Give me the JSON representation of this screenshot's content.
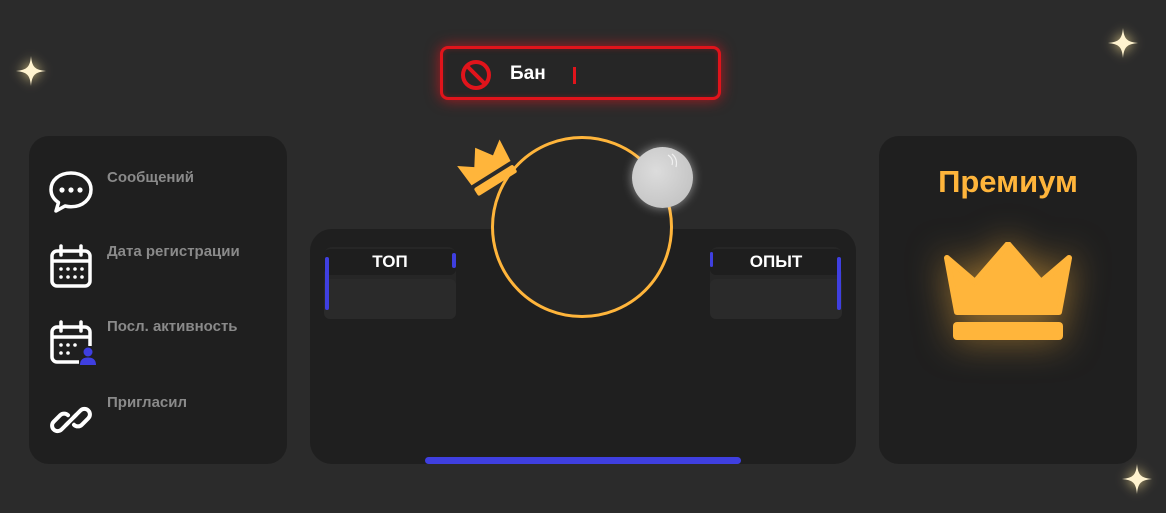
{
  "ban": {
    "label": "Бан",
    "icon": "ban-icon",
    "color": "#e0141b"
  },
  "info": {
    "items": [
      {
        "label": "Сообщений",
        "icon": "chat-bubble-icon"
      },
      {
        "label": "Дата регистрации",
        "icon": "calendar-icon"
      },
      {
        "label": "Посл. активность",
        "icon": "calendar-user-icon"
      },
      {
        "label": "Пригласил",
        "icon": "link-icon"
      }
    ]
  },
  "stats": {
    "top_label": "ТОП",
    "exp_label": "ОПЫТ"
  },
  "premium": {
    "title": "Премиум",
    "icon": "crown-icon",
    "color": "#ffb53b"
  },
  "colors": {
    "accent": "#3f3fe0",
    "gold": "#ffb53b",
    "background": "#2b2b2b",
    "panel": "#1f1f1f"
  }
}
